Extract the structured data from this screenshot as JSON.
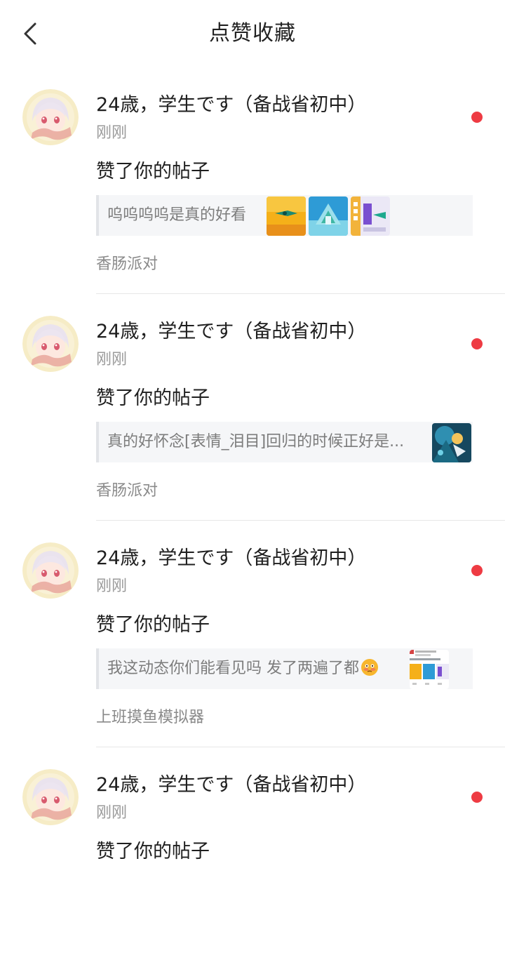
{
  "header": {
    "title": "点赞收藏",
    "back_icon": "chevron-left-icon"
  },
  "colors": {
    "unread_dot": "#ee3b43"
  },
  "notifications": [
    {
      "username": "24歳，学生です（备战省初中）",
      "time": "刚刚",
      "action": "赞了你的帖子",
      "quote": "呜呜呜呜是真的好看",
      "circle": "香肠派对"
    },
    {
      "username": "24歳，学生です（备战省初中）",
      "time": "刚刚",
      "action": "赞了你的帖子",
      "quote": "真的好怀念[表情_泪目]回归的时候正好是...",
      "circle": "香肠派对"
    },
    {
      "username": "24歳，学生です（备战省初中）",
      "time": "刚刚",
      "action": "赞了你的帖子",
      "quote": "我这动态你们能看见吗 发了两遍了都",
      "quote_emoji": "flushed-face-emoji",
      "circle": "上班摸鱼模拟器"
    },
    {
      "username": "24歳，学生です（备战省初中）",
      "time": "刚刚",
      "action": "赞了你的帖子"
    }
  ]
}
